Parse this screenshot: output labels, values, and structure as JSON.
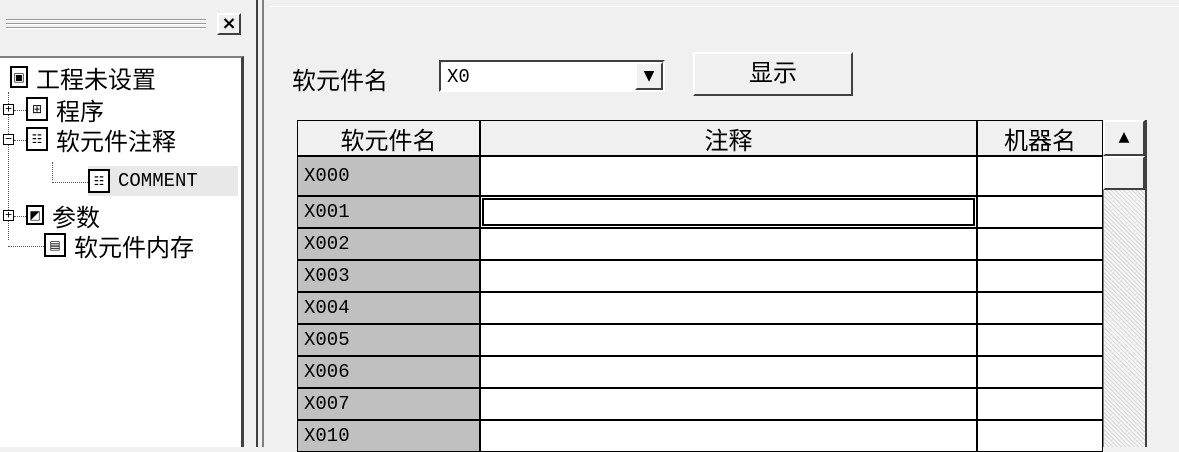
{
  "tree": {
    "close_label": "×",
    "root": {
      "label": "工程未设置",
      "icon": "project-icon"
    },
    "items": [
      {
        "label": "程序",
        "icon": "program-icon",
        "expander": "+"
      },
      {
        "label": "软元件注释",
        "icon": "device-comment-icon",
        "expander": "−"
      },
      {
        "label": "COMMENT",
        "icon": "comment-file-icon"
      },
      {
        "label": "参数",
        "icon": "parameter-icon",
        "expander": "+"
      },
      {
        "label": "软元件内存",
        "icon": "device-memory-icon"
      }
    ]
  },
  "toolbar": {
    "device_name_label": "软元件名",
    "device_value": "X0",
    "dropdown_glyph": "▼",
    "show_button": "显示"
  },
  "table": {
    "columns": [
      "软元件名",
      "注释",
      "机器名"
    ],
    "rows": [
      {
        "device": "X000",
        "comment": "",
        "machine": ""
      },
      {
        "device": "X001",
        "comment": "",
        "machine": ""
      },
      {
        "device": "X002",
        "comment": "",
        "machine": ""
      },
      {
        "device": "X003",
        "comment": "",
        "machine": ""
      },
      {
        "device": "X004",
        "comment": "",
        "machine": ""
      },
      {
        "device": "X005",
        "comment": "",
        "machine": ""
      },
      {
        "device": "X006",
        "comment": "",
        "machine": ""
      },
      {
        "device": "X007",
        "comment": "",
        "machine": ""
      },
      {
        "device": "X010",
        "comment": "",
        "machine": ""
      }
    ],
    "active_row": "X001"
  },
  "scrollbar": {
    "up_glyph": "▲"
  }
}
